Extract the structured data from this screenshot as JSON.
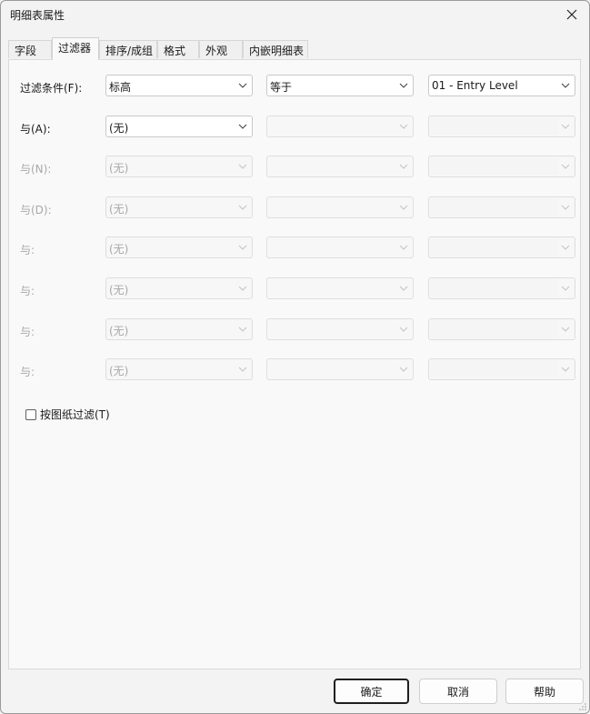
{
  "window": {
    "title": "明细表属性"
  },
  "tabs": [
    {
      "label": "字段"
    },
    {
      "label": "过滤器"
    },
    {
      "label": "排序/成组"
    },
    {
      "label": "格式"
    },
    {
      "label": "外观"
    },
    {
      "label": "内嵌明细表"
    }
  ],
  "filters": {
    "row1": {
      "label": "过滤条件(F):",
      "field": "标高",
      "operator": "等于",
      "value": "01 - Entry Level"
    },
    "row2": {
      "label": "与(A):",
      "field": "(无)"
    },
    "row3": {
      "label": "与(N):",
      "field": "(无)"
    },
    "row4": {
      "label": "与(D):",
      "field": "(无)"
    },
    "row5": {
      "label": "与:",
      "field": "(无)"
    },
    "row6": {
      "label": "与:",
      "field": "(无)"
    },
    "row7": {
      "label": "与:",
      "field": "(无)"
    },
    "row8": {
      "label": "与:",
      "field": "(无)"
    }
  },
  "sheet_filter": {
    "label": "按图纸过滤(T)",
    "checked": false
  },
  "buttons": {
    "ok": "确定",
    "cancel": "取消",
    "help": "帮助"
  }
}
